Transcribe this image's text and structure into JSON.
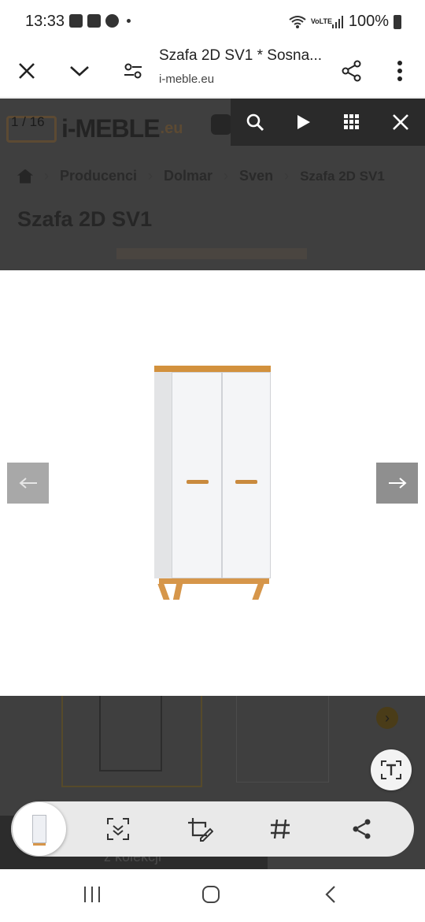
{
  "status_bar": {
    "time": "13:33",
    "icons": [
      "image-icon",
      "checkbox-icon",
      "facebook-icon",
      "dot-icon"
    ],
    "network": "VoLTE",
    "battery": "100%"
  },
  "toolbar": {
    "title": "Szafa 2D SV1 * Sosna...",
    "url": "i-meble.eu"
  },
  "background_page": {
    "logo": "i-MEBLE",
    "logo_suffix": ".eu",
    "breadcrumb": [
      "Producenci",
      "Dolmar",
      "Sven",
      "Szafa 2D SV1"
    ],
    "page_title": "Szafa 2D SV1",
    "bottom_text": "z kolekcji"
  },
  "lightbox": {
    "counter": "1 / 16",
    "controls": [
      "zoom-icon",
      "play-icon",
      "grid-icon",
      "close-icon"
    ]
  },
  "nav": {
    "colors": {
      "accent_wood": "#d2913d",
      "overlay": "#2a2a2a"
    }
  }
}
